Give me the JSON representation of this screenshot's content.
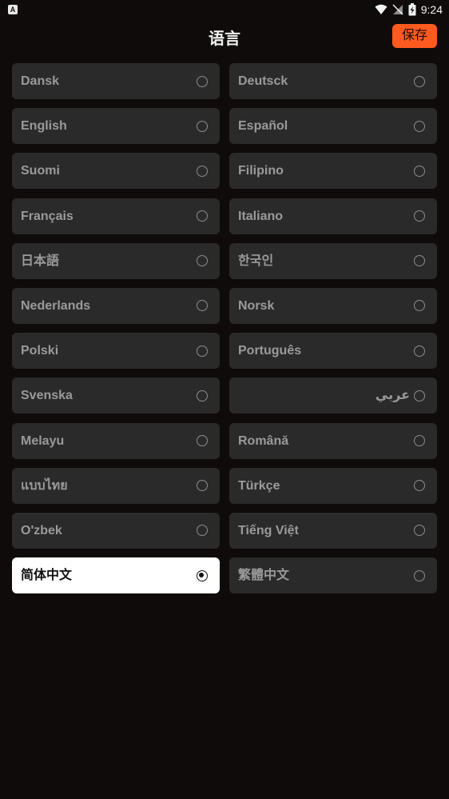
{
  "status_bar": {
    "time": "9:24",
    "left_icon": "A"
  },
  "header": {
    "title": "语言",
    "save_label": "保存"
  },
  "languages": [
    {
      "label": "Dansk",
      "selected": false,
      "rtl": false
    },
    {
      "label": "Deutsck",
      "selected": false,
      "rtl": false
    },
    {
      "label": "English",
      "selected": false,
      "rtl": false
    },
    {
      "label": "Español",
      "selected": false,
      "rtl": false
    },
    {
      "label": "Suomi",
      "selected": false,
      "rtl": false
    },
    {
      "label": "Filipino",
      "selected": false,
      "rtl": false
    },
    {
      "label": "Français",
      "selected": false,
      "rtl": false
    },
    {
      "label": "Italiano",
      "selected": false,
      "rtl": false
    },
    {
      "label": "日本語",
      "selected": false,
      "rtl": false
    },
    {
      "label": "한국인",
      "selected": false,
      "rtl": false
    },
    {
      "label": "Nederlands",
      "selected": false,
      "rtl": false
    },
    {
      "label": "Norsk",
      "selected": false,
      "rtl": false
    },
    {
      "label": "Polski",
      "selected": false,
      "rtl": false
    },
    {
      "label": "Português",
      "selected": false,
      "rtl": false
    },
    {
      "label": "Svenska",
      "selected": false,
      "rtl": false
    },
    {
      "label": "عربي",
      "selected": false,
      "rtl": true
    },
    {
      "label": "Melayu",
      "selected": false,
      "rtl": false
    },
    {
      "label": "Română",
      "selected": false,
      "rtl": false
    },
    {
      "label": "แบบไทย",
      "selected": false,
      "rtl": false
    },
    {
      "label": "Türkçe",
      "selected": false,
      "rtl": false
    },
    {
      "label": "O'zbek",
      "selected": false,
      "rtl": false
    },
    {
      "label": "Tiếng Việt",
      "selected": false,
      "rtl": false
    },
    {
      "label": "简体中文",
      "selected": true,
      "rtl": false
    },
    {
      "label": "繁體中文",
      "selected": false,
      "rtl": false
    }
  ],
  "icons": {
    "wifi": "wifi-icon",
    "signal": "signal-off-icon",
    "battery": "battery-charging-icon",
    "radio": "radio-icon"
  },
  "colors": {
    "background": "#0f0b0a",
    "item_background": "#2a2a2a",
    "selected_background": "#ffffff",
    "accent": "#ff5a1f"
  }
}
